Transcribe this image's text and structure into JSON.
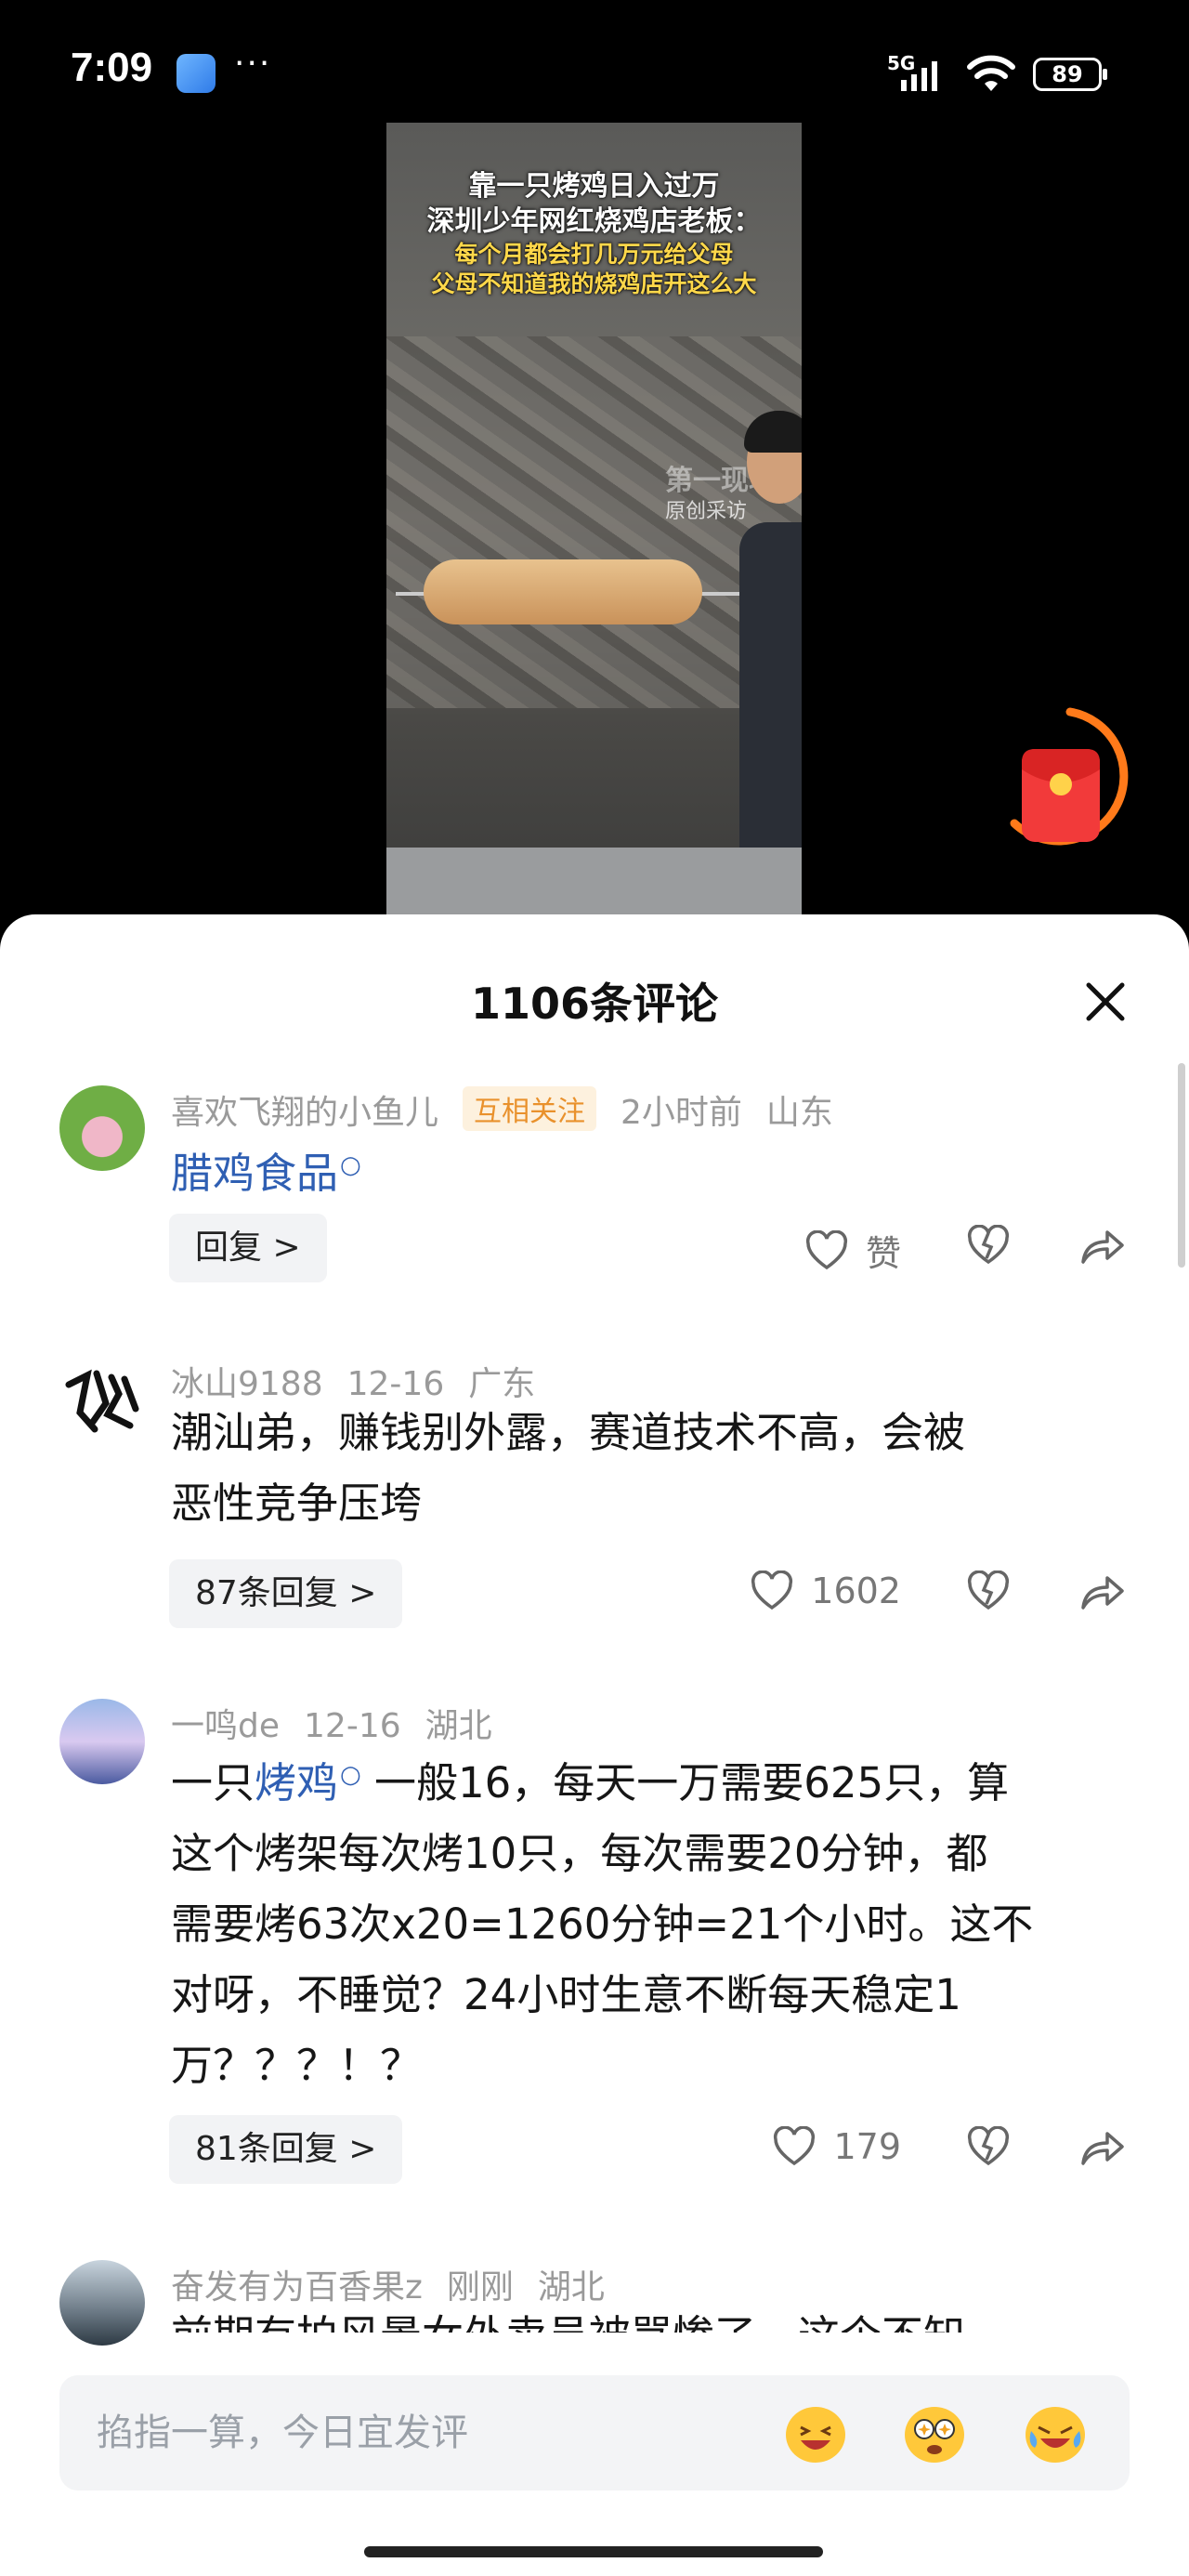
{
  "status_bar": {
    "time": "7:09",
    "app_badge": "2",
    "dots": "···",
    "network": "5G",
    "battery": "89"
  },
  "video": {
    "caption_lines": [
      "靠一只烤鸡日入过万",
      "深圳少年网红烧鸡店老板："
    ],
    "caption_sub_lines": [
      "每个月都会打几万元给父母",
      "父母不知道我的烧鸡店开这么大"
    ],
    "watermark_brand": "第一现场",
    "watermark": "原创采访"
  },
  "comments_sheet": {
    "title": "1106条评论",
    "comments": [
      {
        "username": "喜欢飞翔的小鱼儿",
        "badge": "互相关注",
        "time": "2小时前",
        "location": "山东",
        "text_link": "腊鸡食品",
        "reply_label": "回复 >",
        "like_label": "赞"
      },
      {
        "username": "冰山9188",
        "time": "12-16",
        "location": "广东",
        "text_lines": [
          "潮汕弟，赚钱别外露，赛道技术不高，会被",
          "恶性竞争压垮"
        ],
        "reply_label": "87条回复 >",
        "like_count": "1602"
      },
      {
        "username": "一鸣de",
        "time": "12-16",
        "location": "湖北",
        "text_prefix": "一只",
        "text_link": "烤鸡",
        "text_line1_rest": "一般16，每天一万需要625只，算",
        "text_lines": [
          "这个烤架每次烤10只，每次需要20分钟，都",
          "需要烤63次x20=1260分钟=21个小时。这不",
          "对呀，不睡觉？24小时生意不断每天稳定1",
          "万？？？！？"
        ],
        "reply_label": "81条回复 >",
        "like_count": "179"
      },
      {
        "username": "奋发有为百香果z",
        "time": "刚刚",
        "location": "湖北",
        "text_partial": "前期有拍风景女外卖员被骂惨了，这个不知"
      }
    ]
  },
  "input_bar": {
    "placeholder": "掐指一算，今日宜发评"
  },
  "colors": {
    "link": "#2f5fb3",
    "badge_text": "#e9912c",
    "badge_bg": "#fdf1de"
  }
}
